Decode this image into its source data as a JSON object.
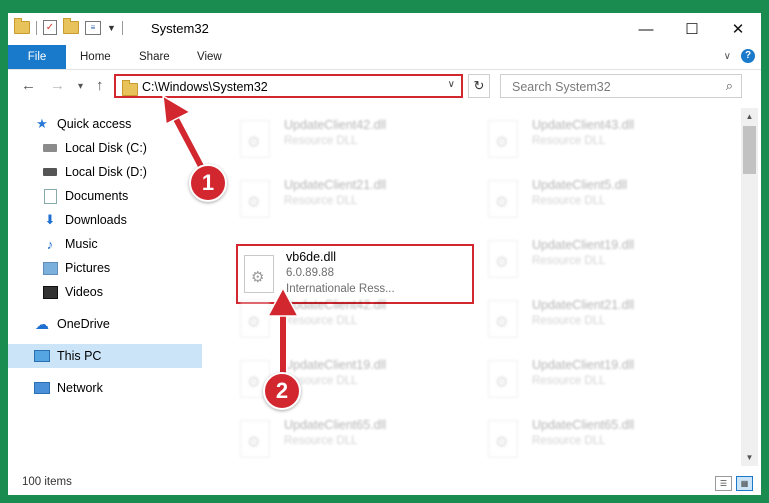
{
  "window": {
    "title": "System32",
    "controls": {
      "minimize": "—",
      "maximize": "☐",
      "close": "✕"
    }
  },
  "ribbon": {
    "tabs": [
      "File",
      "Home",
      "Share",
      "View"
    ],
    "help": "?"
  },
  "navbar": {
    "back": "←",
    "forward": "→",
    "recent": "▾",
    "up": "↑",
    "address": "C:\\Windows\\System32",
    "address_dropdown": "∨",
    "refresh": "↻",
    "search_placeholder": "Search System32",
    "search_icon": "⌕"
  },
  "sidebar": {
    "items": [
      {
        "label": "Quick access",
        "icon": "star-icon"
      },
      {
        "label": "Local Disk (C:)",
        "icon": "drive-icon"
      },
      {
        "label": "Local Disk (D:)",
        "icon": "drive-icon"
      },
      {
        "label": "Documents",
        "icon": "documents-icon",
        "pinned": true
      },
      {
        "label": "Downloads",
        "icon": "downloads-icon",
        "pinned": true
      },
      {
        "label": "Music",
        "icon": "music-icon",
        "pinned": true
      },
      {
        "label": "Pictures",
        "icon": "pictures-icon",
        "pinned": true
      },
      {
        "label": "Videos",
        "icon": "videos-icon",
        "pinned": true
      },
      {
        "label": "OneDrive",
        "icon": "onedrive-icon"
      },
      {
        "label": "This PC",
        "icon": "this-pc-icon",
        "selected": true
      },
      {
        "label": "Network",
        "icon": "network-icon"
      }
    ]
  },
  "files": [
    {
      "name": "UpdateClient42.dll",
      "type": "Resource DLL"
    },
    {
      "name": "UpdateClient43.dll",
      "type": "Resource DLL"
    },
    {
      "name": "UpdateClient21.dll",
      "type": "Resource DLL"
    },
    {
      "name": "UpdateClient5.dll",
      "type": "Resource DLL"
    },
    {
      "name": "vb6de.dll",
      "version": "6.0.89.88",
      "description": "Internationale Ress..."
    },
    {
      "name": "UpdateClient19.dll",
      "type": "Resource DLL"
    },
    {
      "name": "UpdateClient42.dll",
      "type": "Resource DLL"
    },
    {
      "name": "UpdateClient21.dll",
      "type": "Resource DLL"
    },
    {
      "name": "UpdateClient19.dll",
      "type": "Resource DLL"
    },
    {
      "name": "UpdateClient19.dll",
      "type": "Resource DLL"
    },
    {
      "name": "UpdateClient65.dll",
      "type": "Resource DLL"
    },
    {
      "name": "UpdateClient65.dll",
      "type": "Resource DLL"
    }
  ],
  "status": {
    "item_count": "100 items"
  },
  "annotations": {
    "step1": "1",
    "step2": "2",
    "color": "#d2272f"
  },
  "colors": {
    "frame": "#1b8c4f",
    "accent": "#1979ca",
    "selection": "#cce4f7"
  }
}
